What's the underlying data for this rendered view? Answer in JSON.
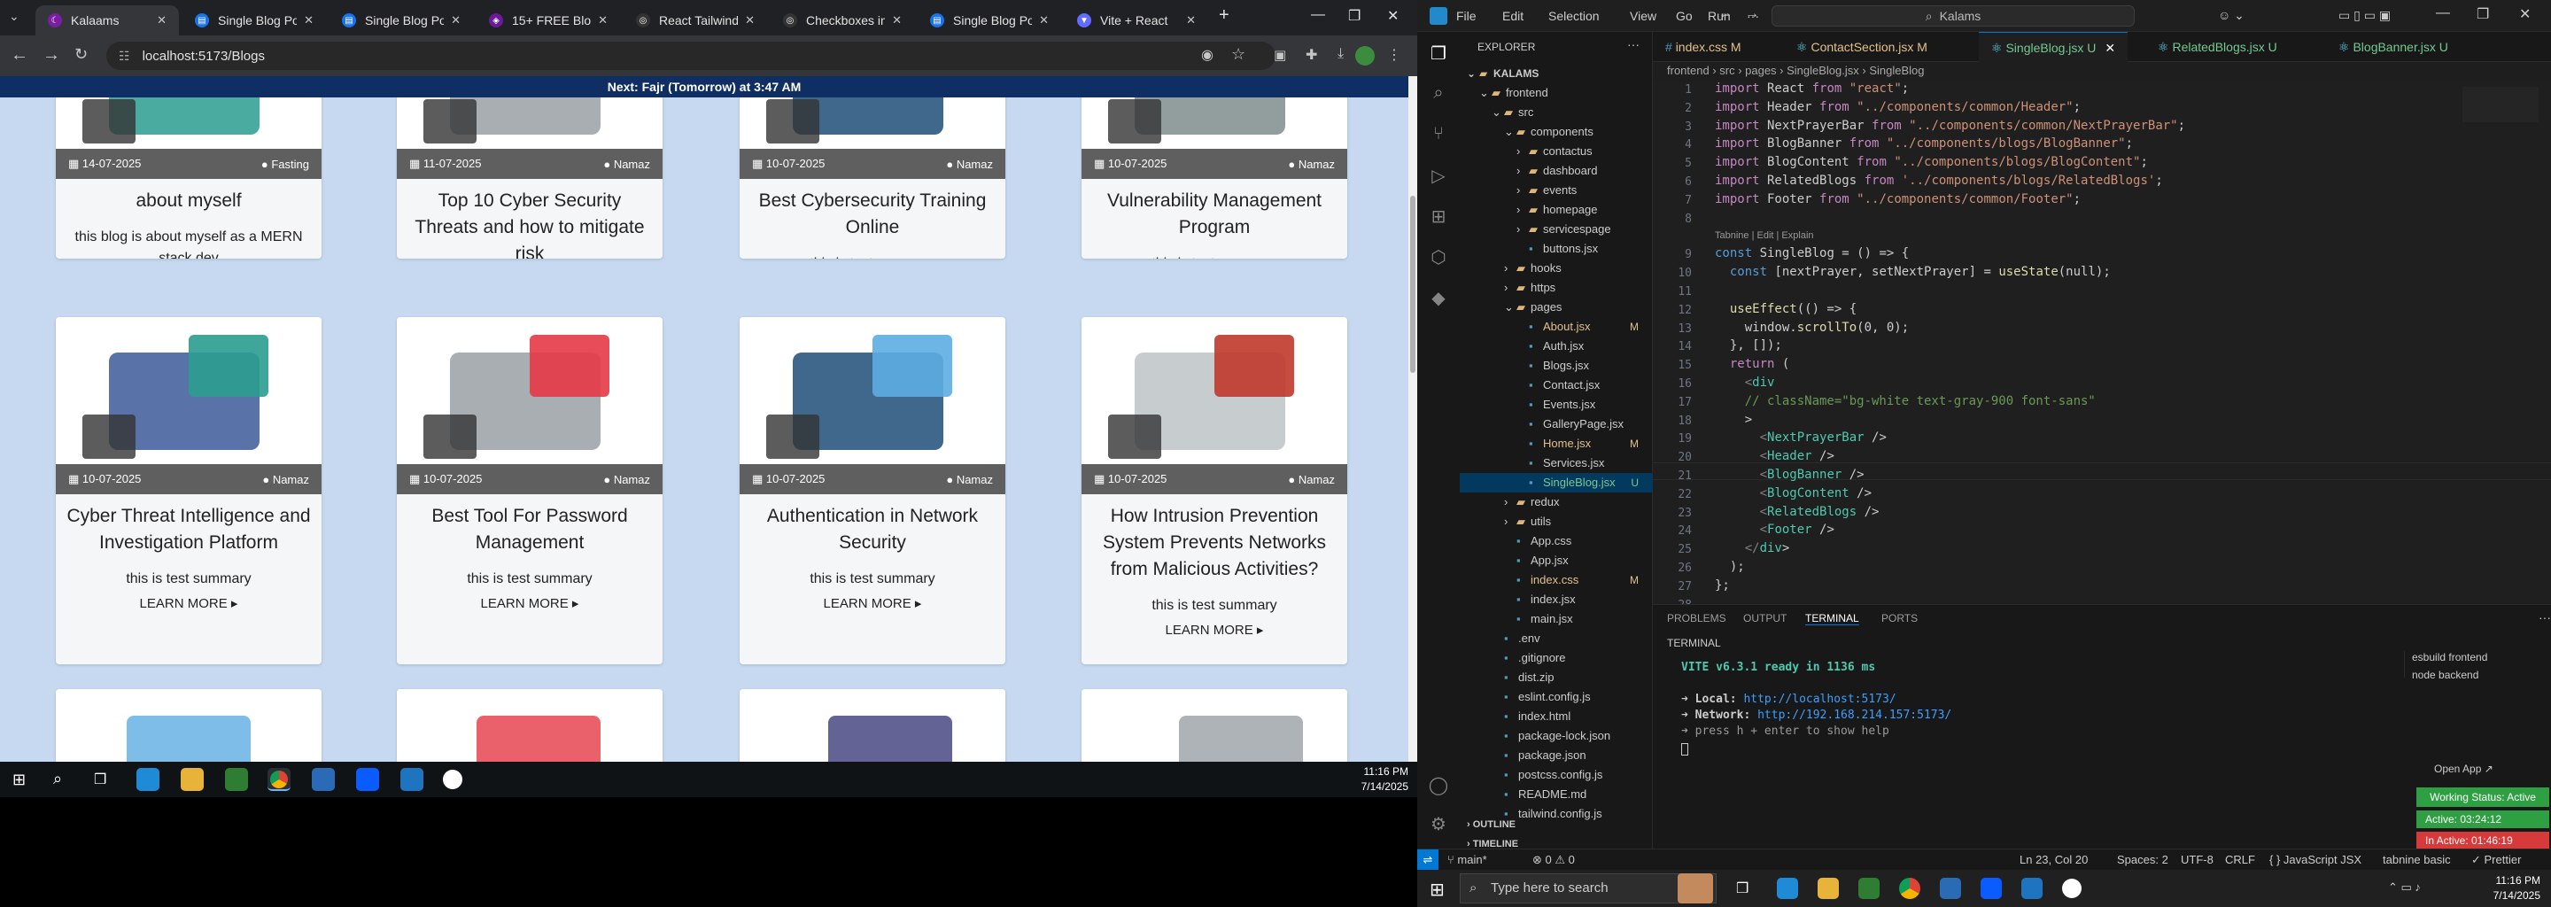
{
  "browser": {
    "tabs": [
      {
        "label": "Kalaams",
        "active": true
      },
      {
        "label": "Single Blog Posts",
        "active": false
      },
      {
        "label": "Single Blog Posts",
        "active": false
      },
      {
        "label": "15+ FREE Blog W",
        "active": false
      },
      {
        "label": "React Tailwind Blo",
        "active": false
      },
      {
        "label": "Checkboxes in Sc",
        "active": false
      },
      {
        "label": "Single Blog Posts",
        "active": false
      },
      {
        "label": "Vite + React",
        "active": false
      }
    ],
    "new_tab": "+",
    "url": "localhost:5173/Blogs"
  },
  "site": {
    "banner": "Next: Fajr (Tomorrow) at 3:47 AM",
    "learn_more": "LEARN MORE ▸",
    "cards": [
      {
        "date": "14-07-2025",
        "category": "Fasting",
        "title": "about myself",
        "summary": "this blog is about myself as a MERN stack dev"
      },
      {
        "date": "11-07-2025",
        "category": "Namaz",
        "title": "Top 10 Cyber Security Threats and how to mitigate risk",
        "summary": "this is test summary"
      },
      {
        "date": "10-07-2025",
        "category": "Namaz",
        "title": "Best Cybersecurity Training Online",
        "summary": "this is test summary"
      },
      {
        "date": "10-07-2025",
        "category": "Namaz",
        "title": "Vulnerability Management Program",
        "summary": "this is test summary"
      },
      {
        "date": "10-07-2025",
        "category": "Namaz",
        "title": "Cyber Threat Intelligence and Investigation Platform",
        "summary": "this is test summary"
      },
      {
        "date": "10-07-2025",
        "category": "Namaz",
        "title": "Best Tool For Password Management",
        "summary": "this is test summary"
      },
      {
        "date": "10-07-2025",
        "category": "Namaz",
        "title": "Authentication in Network Security",
        "summary": "this is test summary"
      },
      {
        "date": "10-07-2025",
        "category": "Namaz",
        "title": "How Intrusion Prevention System Prevents Networks from Malicious Activities?",
        "summary": "this is test summary"
      }
    ]
  },
  "left_taskbar": {
    "time": "11:16 PM",
    "date": "7/14/2025"
  },
  "vscode": {
    "menu": [
      "File",
      "Edit",
      "Selection",
      "View",
      "Go",
      "Run",
      "···"
    ],
    "search": "Kalams",
    "explorer_title": "EXPLORER",
    "tree": [
      {
        "label": "KALAMS",
        "depth": 0,
        "arrow": "⌄",
        "bold": true
      },
      {
        "label": "frontend",
        "depth": 1,
        "arrow": "⌄"
      },
      {
        "label": "src",
        "depth": 2,
        "arrow": "⌄"
      },
      {
        "label": "components",
        "depth": 3,
        "arrow": "⌄"
      },
      {
        "label": "contactus",
        "depth": 4,
        "arrow": "›"
      },
      {
        "label": "dashboard",
        "depth": 4,
        "arrow": "›"
      },
      {
        "label": "events",
        "depth": 4,
        "arrow": "›"
      },
      {
        "label": "homepage",
        "depth": 4,
        "arrow": "›",
        "status": "modified"
      },
      {
        "label": "servicespage",
        "depth": 4,
        "arrow": "›"
      },
      {
        "label": "buttons.jsx",
        "depth": 4,
        "arrow": ""
      },
      {
        "label": "hooks",
        "depth": 3,
        "arrow": "›"
      },
      {
        "label": "https",
        "depth": 3,
        "arrow": "›"
      },
      {
        "label": "pages",
        "depth": 3,
        "arrow": "⌄"
      },
      {
        "label": "About.jsx",
        "depth": 4,
        "arrow": "",
        "badge": "M"
      },
      {
        "label": "Auth.jsx",
        "depth": 4,
        "arrow": ""
      },
      {
        "label": "Blogs.jsx",
        "depth": 4,
        "arrow": ""
      },
      {
        "label": "Contact.jsx",
        "depth": 4,
        "arrow": ""
      },
      {
        "label": "Events.jsx",
        "depth": 4,
        "arrow": ""
      },
      {
        "label": "GalleryPage.jsx",
        "depth": 4,
        "arrow": ""
      },
      {
        "label": "Home.jsx",
        "depth": 4,
        "arrow": "",
        "badge": "M"
      },
      {
        "label": "Services.jsx",
        "depth": 4,
        "arrow": ""
      },
      {
        "label": "SingleBlog.jsx",
        "depth": 4,
        "arrow": "",
        "badge": "U",
        "selected": true
      },
      {
        "label": "redux",
        "depth": 3,
        "arrow": "›"
      },
      {
        "label": "utils",
        "depth": 3,
        "arrow": "›"
      },
      {
        "label": "App.css",
        "depth": 3,
        "arrow": ""
      },
      {
        "label": "App.jsx",
        "depth": 3,
        "arrow": ""
      },
      {
        "label": "index.css",
        "depth": 3,
        "arrow": "",
        "badge": "M"
      },
      {
        "label": "index.jsx",
        "depth": 3,
        "arrow": ""
      },
      {
        "label": "main.jsx",
        "depth": 3,
        "arrow": ""
      },
      {
        "label": ".env",
        "depth": 2,
        "arrow": ""
      },
      {
        "label": ".gitignore",
        "depth": 2,
        "arrow": ""
      },
      {
        "label": "dist.zip",
        "depth": 2,
        "arrow": ""
      },
      {
        "label": "eslint.config.js",
        "depth": 2,
        "arrow": ""
      },
      {
        "label": "index.html",
        "depth": 2,
        "arrow": ""
      },
      {
        "label": "package-lock.json",
        "depth": 2,
        "arrow": ""
      },
      {
        "label": "package.json",
        "depth": 2,
        "arrow": ""
      },
      {
        "label": "postcss.config.js",
        "depth": 2,
        "arrow": ""
      },
      {
        "label": "README.md",
        "depth": 2,
        "arrow": ""
      },
      {
        "label": "tailwind.config.js",
        "depth": 2,
        "arrow": ""
      }
    ],
    "outline": "OUTLINE",
    "timeline": "TIMELINE",
    "editor_tabs": [
      {
        "label": "index.css M",
        "active": false
      },
      {
        "label": "ContactSection.jsx M",
        "active": false
      },
      {
        "label": "SingleBlog.jsx U",
        "active": true
      },
      {
        "label": "RelatedBlogs.jsx U",
        "active": false
      },
      {
        "label": "BlogBanner.jsx U",
        "active": false
      }
    ],
    "breadcrumb": "frontend › src › pages › SingleBlog.jsx › SingleBlog",
    "codelens": "Tabnine | Edit | Explain",
    "code": [
      "import React from \"react\";",
      "import Header from \"../components/common/Header\";",
      "import NextPrayerBar from \"../components/common/NextPrayerBar\";",
      "import BlogBanner from \"../components/blogs/BlogBanner\";",
      "import BlogContent from \"../components/blogs/BlogContent\";",
      "import RelatedBlogs from '../components/blogs/RelatedBlogs';",
      "import Footer from \"../components/common/Footer\";",
      "",
      "const SingleBlog = () => {",
      "  const [nextPrayer, setNextPrayer] = useState(null);",
      "",
      "  useEffect(() => {",
      "    window.scrollTo(0, 0);",
      "  }, []);",
      "  return (",
      "    <div",
      "    // className=\"bg-white text-gray-900 font-sans\"",
      "    >",
      "      <NextPrayerBar />",
      "      <Header />",
      "      <BlogBanner />",
      "      <BlogContent />",
      "      <RelatedBlogs />",
      "      <Footer />",
      "    </div>",
      "  );",
      "};",
      "",
      "export default SingleBlog;",
      ""
    ],
    "panel_tabs": [
      "PROBLEMS",
      "OUTPUT",
      "TERMINAL",
      "PORTS"
    ],
    "terminal_title": "TERMINAL",
    "terminal": {
      "vite_line": "VITE v6.3.1  ready in 1136 ms",
      "local_label": "➜  Local:",
      "local_url": "http://localhost:5173/",
      "network_label": "➜  Network:",
      "network_url": "http://192.168.214.157:5173/",
      "help": "➜  press h + enter to show help"
    },
    "terminal_list": [
      "esbuild frontend",
      "node backend"
    ],
    "open_app": "Open App ↗",
    "working_status": "Working Status: Active",
    "active_time": "Active: 03:24:12",
    "inactive_time": "In Active: 01:46:19",
    "status": {
      "branch": "main*",
      "problems": "⊗ 0 ⚠ 0",
      "position": "Ln 23, Col 20",
      "spaces": "Spaces: 2",
      "encoding": "UTF-8",
      "eol": "CRLF",
      "language": "{ } JavaScript JSX",
      "tabnine": "tabnine basic",
      "prettier": "✓ Prettier"
    }
  },
  "windows_taskbar": {
    "search_placeholder": "Type here to search",
    "time": "11:16 PM",
    "date": "7/14/2025"
  }
}
